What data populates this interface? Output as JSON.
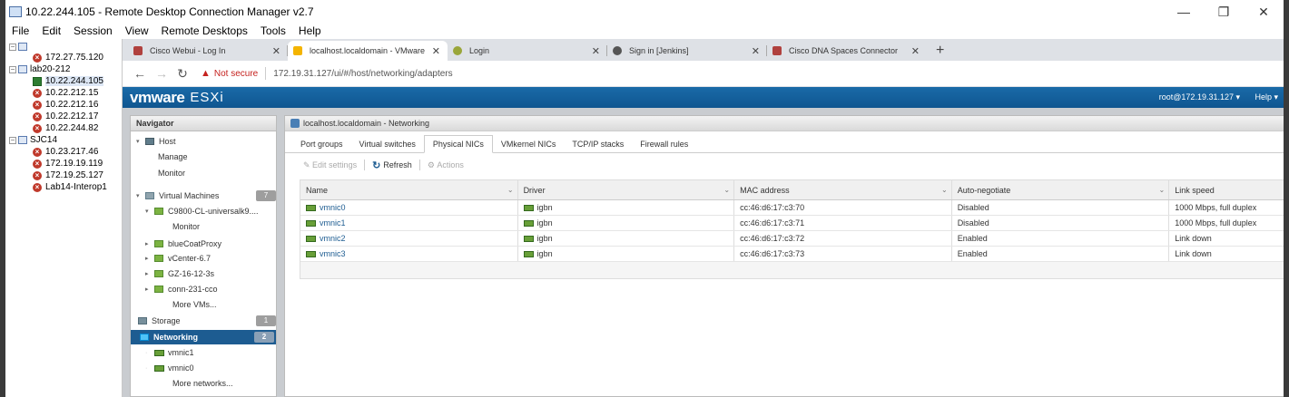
{
  "window": {
    "title": "10.22.244.105 - Remote Desktop Connection Manager v2.7",
    "minimize": "—",
    "maximize": "❐",
    "close": "✕"
  },
  "menu": [
    "File",
    "Edit",
    "Session",
    "View",
    "Remote Desktops",
    "Tools",
    "Help"
  ],
  "tree": {
    "nodes": [
      {
        "label": "",
        "kind": "group"
      },
      {
        "label": "172.27.75.120",
        "kind": "err"
      },
      {
        "label": "lab20-212",
        "kind": "group"
      },
      {
        "label": "10.22.244.105",
        "kind": "ok"
      },
      {
        "label": "10.22.212.15",
        "kind": "err"
      },
      {
        "label": "10.22.212.16",
        "kind": "err"
      },
      {
        "label": "10.22.212.17",
        "kind": "err"
      },
      {
        "label": "10.22.244.82",
        "kind": "err"
      },
      {
        "label": "SJC14",
        "kind": "group"
      },
      {
        "label": "10.23.217.46",
        "kind": "err"
      },
      {
        "label": "172.19.19.119",
        "kind": "err"
      },
      {
        "label": "172.19.25.127",
        "kind": "err"
      },
      {
        "label": "Lab14-Interop1",
        "kind": "err"
      }
    ]
  },
  "browser": {
    "tabs": [
      {
        "title": "Cisco Webui - Log In",
        "color": "#b0413e"
      },
      {
        "title": "localhost.localdomain - VMware",
        "color": "#f4b400"
      },
      {
        "title": "Login",
        "color": "#9aa63a"
      },
      {
        "title": "Sign in [Jenkins]",
        "color": "#555555"
      },
      {
        "title": "Cisco DNA Spaces Connector",
        "color": "#b0413e"
      }
    ],
    "new_tab": "+",
    "not_secure": "Not secure",
    "url": "172.19.31.127/ui/#/host/networking/adapters"
  },
  "esxi": {
    "brand_a": "vmware",
    "brand_b": "ESXi",
    "user": "root@172.19.31.127 ▾",
    "help": "Help ▾"
  },
  "navigator": {
    "title": "Navigator",
    "items": {
      "host": "Host",
      "manage": "Manage",
      "monitor": "Monitor",
      "vms": "Virtual Machines",
      "vms_count": "7",
      "vm1": "C9800-CL-universalk9....",
      "vm1_monitor": "Monitor",
      "vm2": "blueCoatProxy",
      "vm3": "vCenter-6.7",
      "vm4": "GZ-16-12-3s",
      "vm5": "conn-231-cco",
      "more_vms": "More VMs...",
      "storage": "Storage",
      "storage_count": "1",
      "networking": "Networking",
      "networking_count": "2",
      "nic1": "vmnic1",
      "nic0": "vmnic0",
      "more_networks": "More networks..."
    }
  },
  "main": {
    "title": "localhost.localdomain - Networking",
    "tabs": [
      "Port groups",
      "Virtual switches",
      "Physical NICs",
      "VMkernel NICs",
      "TCP/IP stacks",
      "Firewall rules"
    ],
    "active_tab": "Physical NICs",
    "toolbar": {
      "edit": "Edit settings",
      "refresh": "Refresh",
      "actions": "Actions"
    },
    "columns": [
      "Name",
      "Driver",
      "MAC address",
      "Auto-negotiate",
      "Link speed"
    ],
    "rows": [
      [
        "vmnic0",
        "igbn",
        "cc:46:d6:17:c3:70",
        "Disabled",
        "1000 Mbps, full duplex"
      ],
      [
        "vmnic1",
        "igbn",
        "cc:46:d6:17:c3:71",
        "Disabled",
        "1000 Mbps, full duplex"
      ],
      [
        "vmnic2",
        "igbn",
        "cc:46:d6:17:c3:72",
        "Enabled",
        "Link down"
      ],
      [
        "vmnic3",
        "igbn",
        "cc:46:d6:17:c3:73",
        "Enabled",
        "Link down"
      ]
    ]
  }
}
